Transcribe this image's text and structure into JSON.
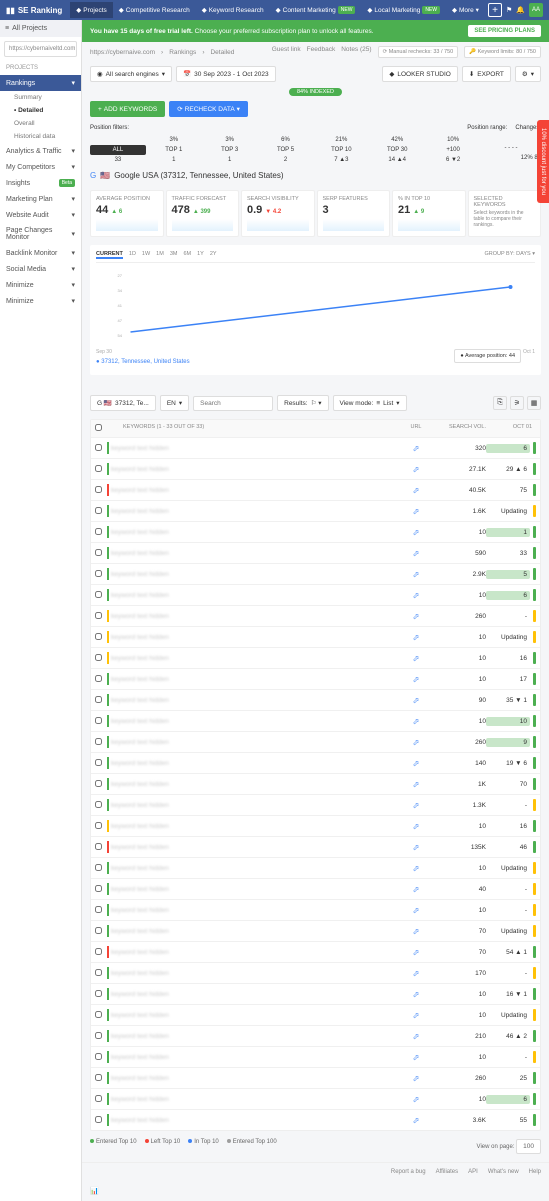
{
  "brand": "SE Ranking",
  "topnav": [
    "Projects",
    "Competitive Research",
    "Keyword Research",
    "Content Marketing",
    "Local Marketing",
    "More"
  ],
  "topnav_badge": "NEW",
  "avatar": "AA",
  "sidebar": {
    "all_projects": "All Projects",
    "url": "https://cybernaiveltd.com",
    "section": "PROJECTS",
    "items": [
      "Rankings",
      "Analytics & Traffic",
      "My Competitors",
      "Insights",
      "Marketing Plan",
      "Website Audit",
      "Page Changes Monitor",
      "Backlink Monitor",
      "Social Media",
      "Minimize",
      "Minimize"
    ],
    "subs": [
      "Summary",
      "Detailed",
      "Overall",
      "Historical data"
    ]
  },
  "trial": {
    "text": "You have 15 days of free trial left.",
    "sub": "Choose your preferred subscription plan to unlock all features.",
    "btn": "SEE PRICING PLANS"
  },
  "crumbs": [
    "https://cybernaive.com",
    "Rankings",
    "Detailed"
  ],
  "crumb_links": [
    "Guest link",
    "Feedback",
    "Notes (25)"
  ],
  "limits": {
    "recheck": "Manual rechecks: 33 / 750",
    "kw": "Keyword limits: 80 / 750"
  },
  "toolbar": {
    "se": "All search engines",
    "date": "30 Sep 2023 - 1 Oct 2023",
    "looker": "LOOKER STUDIO",
    "export": "EXPORT"
  },
  "indexed": "84% INDEXED",
  "btns": {
    "add": "ADD KEYWORDS",
    "recheck": "RECHECK DATA"
  },
  "posfilter_label": "Position filters:",
  "pos_headers": [
    "ALL",
    "TOP 1",
    "TOP 3",
    "TOP 5",
    "TOP 10",
    "TOP 30",
    "+100"
  ],
  "pos_pct": [
    "",
    "3%",
    "3%",
    "6%",
    "21%",
    "42%",
    "10%"
  ],
  "pos_vals": [
    "33",
    "1",
    "1",
    "2",
    "7 ▲3",
    "14 ▲4",
    "6 ▼2"
  ],
  "pos_range": {
    "label": "Position range:",
    "changes": "Changes:",
    "pct": "12%",
    "cnt": "81"
  },
  "se_title": "Google USA (37312, Tennessee, United States)",
  "metrics": [
    {
      "label": "AVERAGE POSITION",
      "val": "44",
      "delta": "▲ 6",
      "cls": "up"
    },
    {
      "label": "TRAFFIC FORECAST",
      "val": "478",
      "delta": "▲ 399",
      "cls": "up"
    },
    {
      "label": "SEARCH VISIBILITY",
      "val": "0.9",
      "delta": "▼ 4.2",
      "cls": "down"
    },
    {
      "label": "SERP FEATURES",
      "val": "3",
      "delta": "",
      "cls": ""
    },
    {
      "label": "% IN TOP 10",
      "val": "21",
      "delta": "▲ 9",
      "cls": "up"
    }
  ],
  "sel_metric": {
    "label": "SELECTED KEYWORDS",
    "desc": "Select keywords in the table to compare their rankings."
  },
  "chart": {
    "tabs": [
      "CURRENT",
      "1D",
      "1W",
      "1M",
      "3M",
      "6M",
      "1Y",
      "2Y"
    ],
    "group": "GROUP BY: DAYS",
    "legend": "Average position: 44",
    "loc": "37312, Tennessee, United States",
    "xstart": "Sep 30",
    "xend": "Oct 1"
  },
  "chart_data": {
    "type": "line",
    "x": [
      "Sep 30",
      "Oct 1"
    ],
    "y": [
      50,
      44
    ],
    "ylabel": "AVERAGE POSITION",
    "yticks": [
      54,
      47,
      41,
      34,
      27
    ]
  },
  "kw_toolbar": {
    "loc": "37312, Te...",
    "lang": "EN",
    "search": "Search",
    "results": "Results:",
    "view": "View mode:",
    "list": "List"
  },
  "thead": {
    "kw": "KEYWORDS (1 - 33 OUT OF 33)",
    "url": "URL",
    "sv": "SEARCH VOL.",
    "oct": "OCT 01"
  },
  "rows": [
    {
      "sv": "320",
      "oct": "6",
      "g": 1,
      "bar": "#4caf50"
    },
    {
      "sv": "27.1K",
      "oct": "29 ▲ 6",
      "bar": "#4caf50"
    },
    {
      "sv": "40.5K",
      "oct": "75",
      "bar": "#f44336"
    },
    {
      "sv": "1.6K",
      "oct": "Updating",
      "bar": "#4caf50"
    },
    {
      "sv": "10",
      "oct": "1",
      "g": 1,
      "bar": "#4caf50"
    },
    {
      "sv": "590",
      "oct": "33",
      "bar": "#4caf50"
    },
    {
      "sv": "2.9K",
      "oct": "5",
      "g": 1,
      "bar": "#4caf50"
    },
    {
      "sv": "10",
      "oct": "6",
      "g": 1,
      "bar": "#4caf50"
    },
    {
      "sv": "260",
      "oct": "-",
      "bar": "#ffc107"
    },
    {
      "sv": "10",
      "oct": "Updating",
      "bar": "#ffc107"
    },
    {
      "sv": "10",
      "oct": "16",
      "bar": "#ffc107"
    },
    {
      "sv": "10",
      "oct": "17",
      "bar": "#4caf50"
    },
    {
      "sv": "90",
      "oct": "35 ▼ 1",
      "bar": "#4caf50"
    },
    {
      "sv": "10",
      "oct": "10",
      "g": 1,
      "bar": "#4caf50"
    },
    {
      "sv": "260",
      "oct": "9",
      "g": 1,
      "bar": "#4caf50"
    },
    {
      "sv": "140",
      "oct": "19 ▼ 6",
      "bar": "#4caf50"
    },
    {
      "sv": "1K",
      "oct": "70",
      "bar": "#4caf50"
    },
    {
      "sv": "1.3K",
      "oct": "-",
      "bar": "#4caf50"
    },
    {
      "sv": "10",
      "oct": "16",
      "bar": "#ffc107"
    },
    {
      "sv": "135K",
      "oct": "46",
      "bar": "#f44336"
    },
    {
      "sv": "10",
      "oct": "Updating",
      "bar": "#4caf50"
    },
    {
      "sv": "40",
      "oct": "-",
      "bar": "#4caf50"
    },
    {
      "sv": "10",
      "oct": "-",
      "bar": "#4caf50"
    },
    {
      "sv": "70",
      "oct": "Updating",
      "bar": "#4caf50"
    },
    {
      "sv": "70",
      "oct": "54 ▲ 1",
      "bar": "#f44336"
    },
    {
      "sv": "170",
      "oct": "-",
      "bar": "#4caf50"
    },
    {
      "sv": "10",
      "oct": "16 ▼ 1",
      "bar": "#4caf50"
    },
    {
      "sv": "10",
      "oct": "Updating",
      "bar": "#4caf50"
    },
    {
      "sv": "210",
      "oct": "46 ▲ 2",
      "bar": "#4caf50"
    },
    {
      "sv": "10",
      "oct": "-",
      "bar": "#4caf50"
    },
    {
      "sv": "260",
      "oct": "25",
      "bar": "#4caf50"
    },
    {
      "sv": "10",
      "oct": "6",
      "g": 1,
      "bar": "#4caf50"
    },
    {
      "sv": "3.6K",
      "oct": "55",
      "bar": "#4caf50"
    }
  ],
  "legend": [
    "Entered Top 10",
    "Left Top 10",
    "In Top 10",
    "Entered Top 100"
  ],
  "viewpage": {
    "label": "View on page:",
    "val": "100"
  },
  "footer": [
    "Report a bug",
    "Affiliates",
    "API",
    "What's new",
    "Help"
  ],
  "promo": "10% discount just for you"
}
